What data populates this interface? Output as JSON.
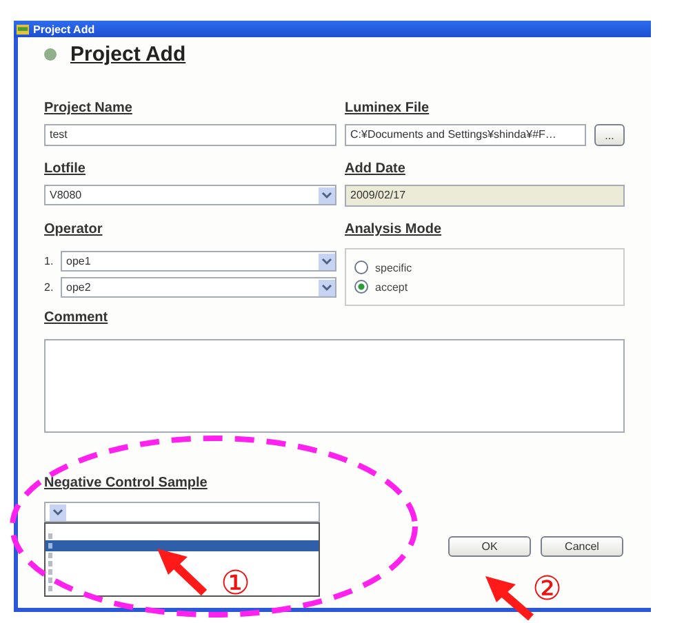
{
  "window": {
    "title": "Project Add"
  },
  "heading": "Project Add",
  "project_name": {
    "label": "Project Name",
    "value": "test"
  },
  "luminex_file": {
    "label": "Luminex File",
    "value": "C:¥Documents and Settings¥shinda¥#F…",
    "browse": "..."
  },
  "lotfile": {
    "label": "Lotfile",
    "value": "V8080"
  },
  "add_date": {
    "label": "Add Date",
    "value": "2009/02/17"
  },
  "operator": {
    "label": "Operator",
    "rows": [
      {
        "number": "1.",
        "value": "ope1"
      },
      {
        "number": "2.",
        "value": "ope2"
      }
    ]
  },
  "analysis_mode": {
    "label": "Analysis Mode",
    "options": [
      {
        "label": "specific",
        "selected": false
      },
      {
        "label": "accept",
        "selected": true
      }
    ]
  },
  "comment": {
    "label": "Comment"
  },
  "negative_control_sample": {
    "label": "Negative Control Sample",
    "expanded": true,
    "list_items": [
      {
        "selected": false
      },
      {
        "selected": true
      },
      {
        "selected": false
      },
      {
        "selected": false
      },
      {
        "selected": false
      },
      {
        "selected": false
      },
      {
        "selected": false
      }
    ]
  },
  "buttons": [
    "OK",
    "Cancel"
  ],
  "annotations": [
    {
      "marker": "①"
    },
    {
      "marker": "②"
    }
  ]
}
